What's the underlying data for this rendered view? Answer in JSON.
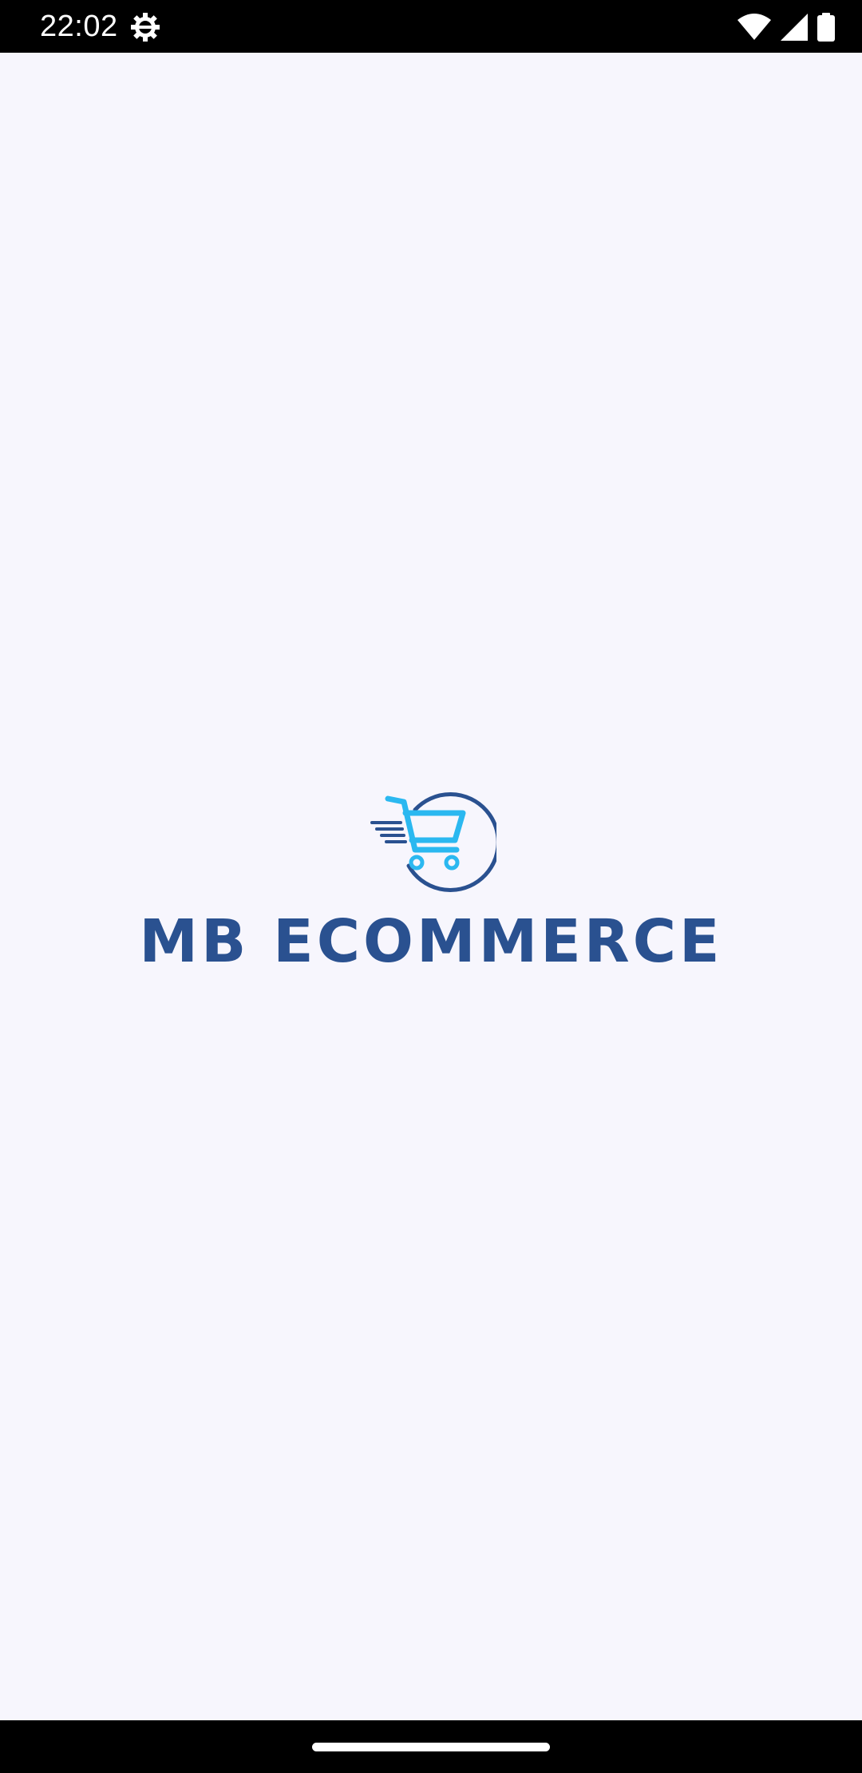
{
  "status_bar": {
    "time": "22:02",
    "left_icons": [
      "settings-gear-icon"
    ],
    "right_icons": [
      "wifi-icon",
      "cell-signal-icon",
      "battery-icon"
    ]
  },
  "splash": {
    "brand_name": "MB ECOMMERCE",
    "logo_icon": "shopping-cart-icon",
    "colors": {
      "background": "#f7f6fd",
      "brand_text": "#2a5190",
      "cart": "#2bb8f0",
      "ring": "#2a5190"
    }
  },
  "nav_bar": {
    "handle": "home-gesture-handle"
  }
}
